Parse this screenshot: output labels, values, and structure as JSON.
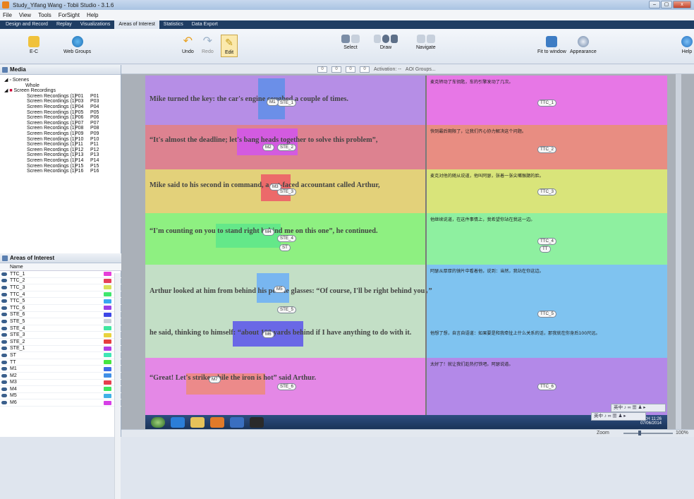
{
  "window": {
    "title": "Study_Yifang Wang - Tobii Studio - 3.1.6",
    "buttons": [
      "–",
      "▢",
      "x"
    ]
  },
  "menu": [
    "File",
    "View",
    "Tools",
    "ForSight",
    "Help"
  ],
  "tabs": [
    "Design and Record",
    "Replay",
    "Visualizations",
    "Areas of Interest",
    "Statistics",
    "Data Export"
  ],
  "active_tab": "Areas of Interest",
  "ribbon": {
    "ec": "E-C",
    "web_groups": "Web Groups",
    "undo": "Undo",
    "redo": "Redo",
    "edit": "Edit",
    "select": "Select",
    "draw": "Draw",
    "navigate": "Navigate",
    "fit_to_window": "Fit to window",
    "appearance": "Appearance",
    "help": "Help"
  },
  "subbar": {
    "v1": "0",
    "v2": "0",
    "v3": "0",
    "v4": "0",
    "activation": "Activation: --",
    "aoi_groups": "AOI Groups..."
  },
  "media": {
    "title": "Media",
    "scenes": "Scenes",
    "whole": "Whole",
    "screen_recordings": "Screen Recordings",
    "recordings": [
      {
        "name": "Screen Recordings (1)",
        "p": "P01",
        "q": "P01"
      },
      {
        "name": "Screen Recordings (1)",
        "p": "P03",
        "q": "P03"
      },
      {
        "name": "Screen Recordings (1)",
        "p": "P04",
        "q": "P04"
      },
      {
        "name": "Screen Recordings (1)",
        "p": "P05",
        "q": "P05"
      },
      {
        "name": "Screen Recordings (1)",
        "p": "P06",
        "q": "P06"
      },
      {
        "name": "Screen Recordings (1)",
        "p": "P07",
        "q": "P07"
      },
      {
        "name": "Screen Recordings (1)",
        "p": "P08",
        "q": "P08"
      },
      {
        "name": "Screen Recordings (1)",
        "p": "P09",
        "q": "P09"
      },
      {
        "name": "Screen Recordings (1)",
        "p": "P10",
        "q": "P10"
      },
      {
        "name": "Screen Recordings (1)",
        "p": "P11",
        "q": "P11"
      },
      {
        "name": "Screen Recordings (1)",
        "p": "P12",
        "q": "P12"
      },
      {
        "name": "Screen Recordings (1)",
        "p": "P13",
        "q": "P13"
      },
      {
        "name": "Screen Recordings (1)",
        "p": "P14",
        "q": "P14"
      },
      {
        "name": "Screen Recordings (1)",
        "p": "P15",
        "q": "P15"
      },
      {
        "name": "Screen Recordings (1)",
        "p": "P16",
        "q": "P16"
      }
    ]
  },
  "aoi_panel": {
    "title": "Areas of Interest",
    "column": "Name",
    "items": [
      {
        "name": "TTC_1",
        "color": "#e63fd9"
      },
      {
        "name": "TTC_2",
        "color": "#e6405a"
      },
      {
        "name": "TTC_3",
        "color": "#d8e05a"
      },
      {
        "name": "TTC_4",
        "color": "#3fe66d"
      },
      {
        "name": "TTC_5",
        "color": "#39a8f0"
      },
      {
        "name": "TTC_6",
        "color": "#9a40e6"
      },
      {
        "name": "STE_6",
        "color": "#3d47e6"
      },
      {
        "name": "STE_5",
        "color": "#c8ced6"
      },
      {
        "name": "STE_4",
        "color": "#3fe6a0"
      },
      {
        "name": "STE_3",
        "color": "#e8d23f"
      },
      {
        "name": "STE_2",
        "color": "#e63f3f"
      },
      {
        "name": "STE_1",
        "color": "#b03fe6"
      },
      {
        "name": "ST",
        "color": "#3fe6b5"
      },
      {
        "name": "TT",
        "color": "#45e640"
      },
      {
        "name": "M1",
        "color": "#3f6de6"
      },
      {
        "name": "M2",
        "color": "#3f8fe6"
      },
      {
        "name": "M3",
        "color": "#e63f4f"
      },
      {
        "name": "M4",
        "color": "#3fe661"
      },
      {
        "name": "M5",
        "color": "#3fb0e6"
      },
      {
        "name": "M6",
        "color": "#d63fe6"
      }
    ]
  },
  "stimulus": {
    "rows": [
      {
        "en": "Mike turned the key: the car's engine coughed a couple of times.",
        "zh": "麦克转动了车钥匙，车的引擎发动了几次。",
        "ste": "STE_1",
        "ttc": "TTC_1",
        "m": "M1",
        "band": "#b68ee6",
        "right": "#e777e6",
        "hl": "#6b8fe8"
      },
      {
        "en": "“It's almost the deadline; let's bang heads together to solve this problem”,",
        "zh": "快到最后期限了，让我们齐心协力解决这个问题。",
        "ste": "STE_2",
        "ttc": "TTC_2",
        "m": "M2",
        "band": "#dd8290",
        "right": "#e88d82",
        "hl": "#d35be0"
      },
      {
        "en": "Mike said to his second in command, a rat-faced accountant called Arthur,",
        "zh": "麦克对他的随从说道，他叫阿瑟，张着一张尖嘴猴腮的脸。",
        "ste": "STE_3",
        "ttc": "TTC_3",
        "m": "M3",
        "band": "#e3d17a",
        "right": "#d9e47a",
        "hl": "#ec6a6a"
      },
      {
        "en": "“I'm counting on you to stand right behind me on this one”, he continued.",
        "zh": "他继续说道，在这件事情上，我希望你站在我这一边。",
        "ste": "STE_4",
        "extra": "ST",
        "ttc": "TTC_4",
        "extra2": "TT",
        "m": "M4",
        "band": "#8ef081",
        "right": "#8ef0a0",
        "hl": "#64e889"
      },
      {
        "en": "Arthur looked at him from behind his pebble glasses: “Of course, I'll be right behind you，”",
        "en2": "he said, thinking to himself: “about 100 yards behind if I have anything to do with it.",
        "zh": "阿瑟从厚厚的镜片中看着他，说到：当然，我站在你这边。",
        "zh2": "他想了想，自言自语道：如果要是和我牵扯上什么关系的话，那我就在你身后100尺远。",
        "ste": "STE_5",
        "ttc": "TTC_5",
        "m": "M5",
        "m6": "M6",
        "band": "#c3dfc6",
        "right": "#7fc3f0",
        "hl": "#78b6f0",
        "hl2": "#6a68e6"
      },
      {
        "en": "“Great! Let's strike while the iron is hot” said Arthur.",
        "zh": "太好了！就让我们趁热打铁吧。阿瑟说道。",
        "ste": "STE_6",
        "ttc": "TTC_6",
        "m": "M7",
        "band": "#e488e6",
        "right": "#b389e8",
        "hl": "#ec8a8a"
      }
    ]
  },
  "statusbar": {
    "zoom": "Zoom",
    "zoom_pct": "100%"
  },
  "taskbar": {
    "time": "11:26",
    "date": "07/06/2014",
    "lang": "CH"
  },
  "langbar": {
    "text": "英中 ♪ ∞ ▦ ♟ ▸"
  }
}
